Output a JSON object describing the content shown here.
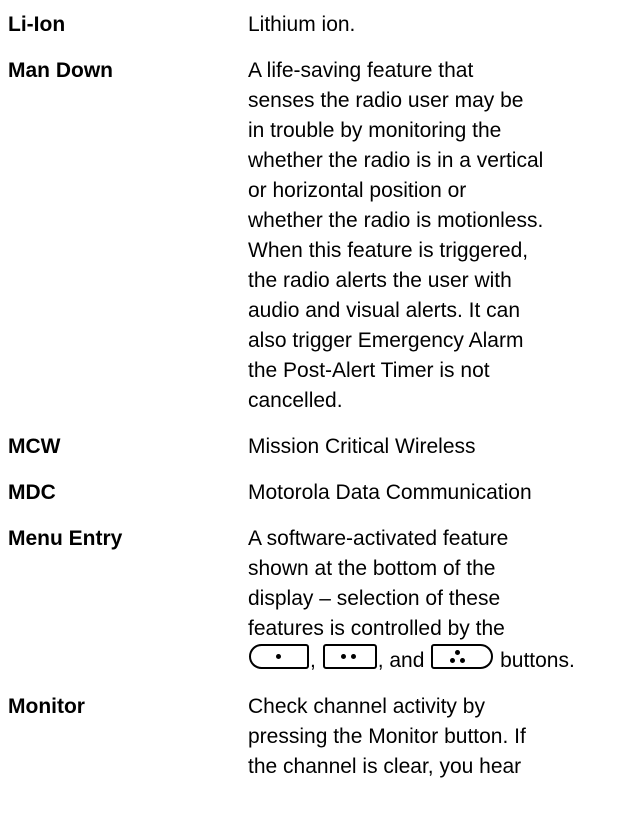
{
  "entries": [
    {
      "term": "Li-Ion",
      "def_lines": [
        "Lithium ion."
      ]
    },
    {
      "term": "Man Down",
      "def_lines": [
        "A life-saving feature that",
        "senses the radio user may be",
        "in trouble by monitoring the",
        "whether the radio is in a vertical",
        "or horizontal position or",
        "whether the radio is motionless.",
        "When this feature is triggered,",
        "the radio alerts the user with",
        "audio and visual alerts. It can",
        "also trigger Emergency Alarm",
        "the Post-Alert Timer is not",
        "cancelled."
      ]
    },
    {
      "term": "MCW",
      "def_lines": [
        "Mission Critical Wireless"
      ]
    },
    {
      "term": "MDC",
      "def_lines": [
        "Motorola Data Communication"
      ]
    },
    {
      "term": "Menu Entry",
      "def_lines": [
        "A software-activated feature",
        "shown at the bottom of the",
        "display – selection of these",
        "features is controlled by the"
      ],
      "buttons_line": {
        "sep1": ",",
        "sep2": ", and",
        "tail": "buttons.",
        "icons": [
          "menu-select-left-button-icon",
          "menu-select-center-button-icon",
          "menu-select-right-button-icon"
        ]
      }
    },
    {
      "term": "Monitor",
      "def_lines": [
        "Check channel activity by",
        "pressing the Monitor button. If",
        "the channel is clear, you hear"
      ]
    }
  ]
}
